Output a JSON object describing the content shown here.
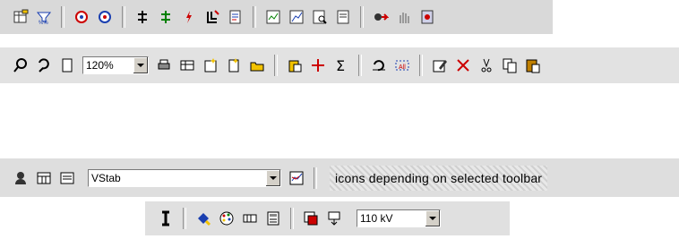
{
  "toolbar1": {
    "icons": [
      "table-edit-icon",
      "filter-icon",
      "network-icon",
      "network-alt-icon",
      "line-icon",
      "line-green-icon",
      "flash-icon",
      "branch-icon",
      "report-icon",
      "diagram-icon",
      "graph-icon",
      "zoom-doc-icon",
      "doc-icon",
      "pipe-icon",
      "hand-icon",
      "exit-icon"
    ]
  },
  "toolbar2": {
    "zoom_value": "120%",
    "icons": [
      "zoom-icon",
      "zoom-back-icon",
      "page-icon",
      "print-icon",
      "table-icon",
      "new-icon",
      "new-doc-icon",
      "open-icon",
      "paste-special-icon",
      "cross-icon",
      "sum-icon",
      "undo-icon",
      "select-icon",
      "edit-icon",
      "delete-icon",
      "cut-icon",
      "copy-icon",
      "paste-icon"
    ]
  },
  "toolbar3": {
    "combo_value": "VStab",
    "note": "icons depending on selected toolbar",
    "icons": [
      "person-icon",
      "table-view-icon",
      "list-view-icon",
      "chart-icon"
    ]
  },
  "toolbar4": {
    "voltage_value": "110 kV",
    "icons": [
      "cursor-icon",
      "fill-icon",
      "palette-icon",
      "grid-icon",
      "calc-icon",
      "table-select-icon",
      "pin-icon"
    ]
  },
  "colors": {
    "accent_red": "#cc0000",
    "accent_green": "#008000",
    "accent_blue": "#1a3fb0"
  }
}
